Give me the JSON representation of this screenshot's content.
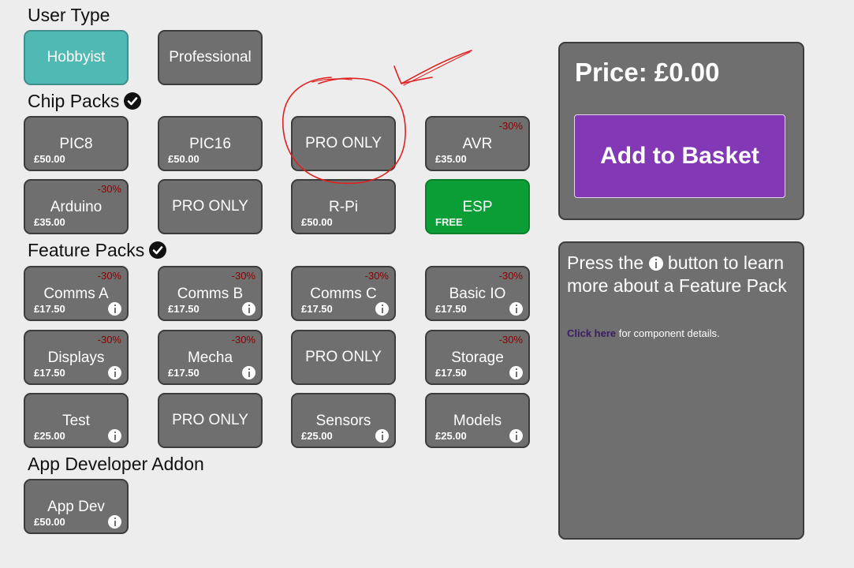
{
  "sections": {
    "user_type": "User Type",
    "chip_packs": "Chip Packs",
    "feature_packs": "Feature Packs",
    "app_developer": "App Developer Addon"
  },
  "user_types": [
    {
      "label": "Hobbyist"
    },
    {
      "label": "Professional"
    }
  ],
  "chips": [
    {
      "name": "PIC8",
      "price": "£50.00"
    },
    {
      "name": "PIC16",
      "price": "£50.00"
    },
    {
      "name": "PRO ONLY"
    },
    {
      "name": "AVR",
      "price": "£35.00",
      "discount": "-30%"
    },
    {
      "name": "Arduino",
      "price": "£35.00",
      "discount": "-30%"
    },
    {
      "name": "PRO ONLY"
    },
    {
      "name": "R-Pi",
      "price": "£50.00"
    },
    {
      "name": "ESP",
      "price": "FREE"
    }
  ],
  "features": [
    {
      "name": "Comms A",
      "price": "£17.50",
      "discount": "-30%"
    },
    {
      "name": "Comms B",
      "price": "£17.50",
      "discount": "-30%"
    },
    {
      "name": "Comms C",
      "price": "£17.50",
      "discount": "-30%"
    },
    {
      "name": "Basic IO",
      "price": "£17.50",
      "discount": "-30%"
    },
    {
      "name": "Displays",
      "price": "£17.50",
      "discount": "-30%"
    },
    {
      "name": "Mecha",
      "price": "£17.50",
      "discount": "-30%"
    },
    {
      "name": "PRO ONLY"
    },
    {
      "name": "Storage",
      "price": "£17.50",
      "discount": "-30%"
    },
    {
      "name": "Test",
      "price": "£25.00"
    },
    {
      "name": "PRO ONLY"
    },
    {
      "name": "Sensors",
      "price": "£25.00"
    },
    {
      "name": "Models",
      "price": "£25.00"
    }
  ],
  "app_dev": {
    "name": "App Dev",
    "price": "£50.00"
  },
  "price_panel": {
    "price_label": "Price:  £0.00",
    "basket_label": "Add to Basket"
  },
  "info_panel": {
    "line_before": "Press the ",
    "line_after": " button to learn more about a Feature Pack",
    "link": "Click here",
    "link_after": " for component details."
  },
  "colors": {
    "tile": "#6f6f6f",
    "selected": "#51b9b3",
    "free": "#0c9e36",
    "basket": "#8338b6",
    "discount": "#8b0000",
    "annotation": "#e02020"
  }
}
